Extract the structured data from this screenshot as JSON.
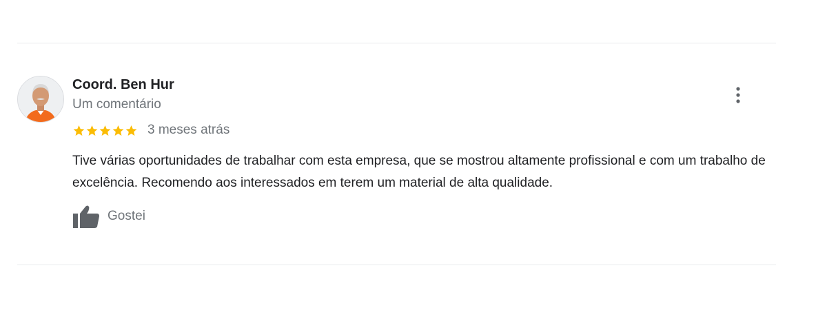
{
  "review": {
    "author_name": "Coord. Ben Hur",
    "author_meta": "Um comentário",
    "rating": 5,
    "max_rating": 5,
    "time_ago": "3 meses atrás",
    "text": "Tive várias oportunidades de trabalhar com esta empresa, que se mostrou altamente profissional e com um trabalho de excelência. Recomendo aos interessados em terem um material de alta qualidade.",
    "like_label": "Gostei"
  },
  "colors": {
    "star": "#fbbc04",
    "text_primary": "#202124",
    "text_secondary": "#70757a",
    "divider": "#e8eaed",
    "icon": "#5f6368"
  },
  "icons": {
    "avatar": "user-photo",
    "star": "star-icon",
    "like": "thumbs-up-icon",
    "more": "more-vertical-icon"
  }
}
